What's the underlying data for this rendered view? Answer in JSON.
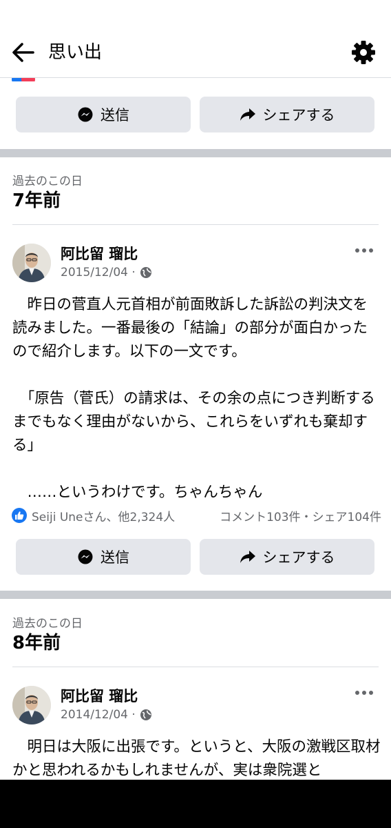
{
  "header": {
    "title": "思い出"
  },
  "actions": {
    "send_label": "送信",
    "share_label": "シェアする"
  },
  "memories": [
    {
      "section_label": "過去のこの日",
      "years_ago": "7年前",
      "author": "阿比留 瑠比",
      "date": "2015/12/04 ·",
      "text": "　昨日の菅直人元首相が前面敗訴した訴訟の判決文を読みました。一番最後の「結論」の部分が面白かったので紹介します。以下の一文です。\n\n　「原告（菅氏）の請求は、その余の点につき判断するまでもなく理由がないから、これらをいずれも棄却する」\n\n　……というわけです。ちゃんちゃん",
      "reactions": "Seiji Uneさん、他2,324人",
      "stats": "コメント103件・シェア104件"
    },
    {
      "section_label": "過去のこの日",
      "years_ago": "8年前",
      "author": "阿比留 瑠比",
      "date": "2014/12/04 ·",
      "text": "　明日は大阪に出張です。というと、大阪の激戦区取材かと思われるかもしれませんが、実は衆院選と"
    }
  ],
  "colors": {
    "like_blue": "#1877f2",
    "separator": "#c9ccd1",
    "button_bg": "#e4e6eb",
    "meta_gray": "#65676b"
  }
}
